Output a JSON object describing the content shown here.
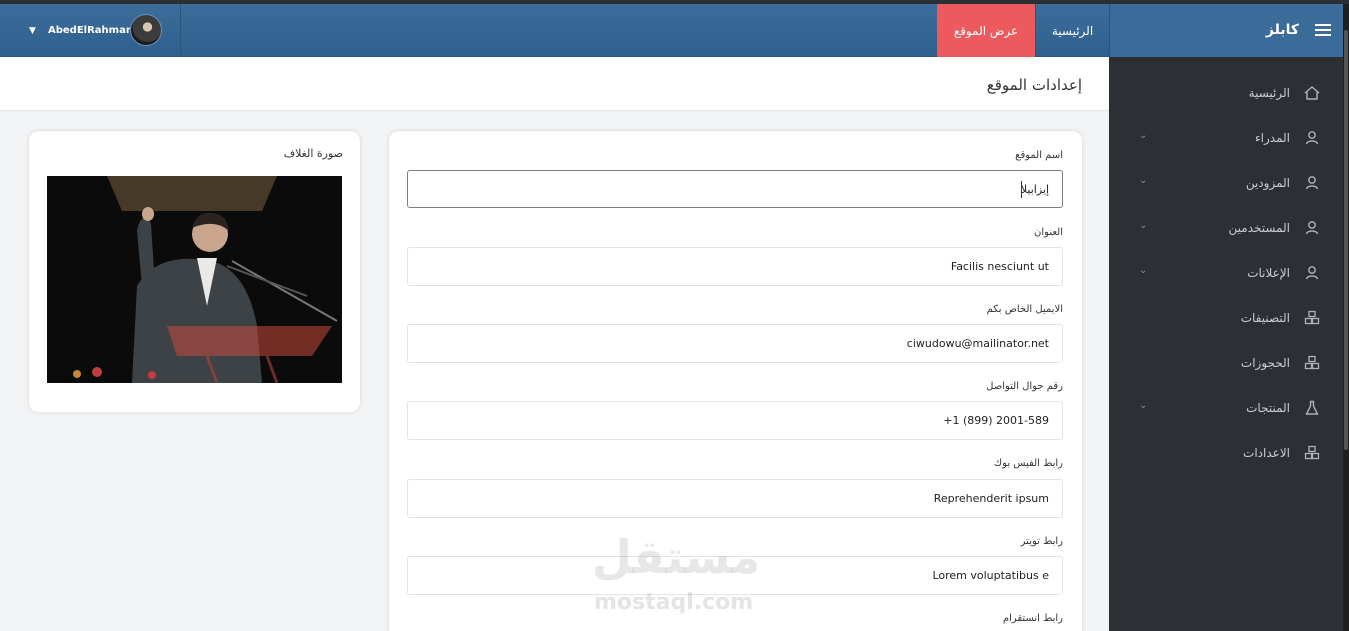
{
  "header": {
    "brand": "كابلز",
    "nav_home": "الرئيسية",
    "nav_view_site": "عرض الموقع",
    "user_name": "AbedElRahman"
  },
  "page": {
    "title": "إعدادات الموقع"
  },
  "sidebar": {
    "items": [
      {
        "label": "الرئيسية",
        "icon": "home-icon",
        "has_caret": false
      },
      {
        "label": "المدراء",
        "icon": "user-icon",
        "has_caret": true
      },
      {
        "label": "المزودين",
        "icon": "user-icon",
        "has_caret": true
      },
      {
        "label": "المستخدمين",
        "icon": "user-icon",
        "has_caret": true
      },
      {
        "label": "الإعلانات",
        "icon": "user-icon",
        "has_caret": true
      },
      {
        "label": "التصنيفات",
        "icon": "cubes-icon",
        "has_caret": false
      },
      {
        "label": "الحجوزات",
        "icon": "cubes-icon",
        "has_caret": false
      },
      {
        "label": "المنتجات",
        "icon": "flask-icon",
        "has_caret": true
      },
      {
        "label": "الاعدادات",
        "icon": "cubes-icon",
        "has_caret": false
      }
    ]
  },
  "form": {
    "site_name": {
      "label": "اسم الموقع",
      "value": "إيزابيلا"
    },
    "address": {
      "label": "العنوان",
      "value": "Facilis nesciunt ut"
    },
    "email": {
      "label": "الايميل الخاص بكم",
      "value": "ciwudowu@mailinator.net"
    },
    "phone": {
      "label": "رقم جوال التواصل",
      "value": "+1 (899) 2001-589"
    },
    "facebook": {
      "label": "رابط الفيس بوك",
      "value": "Reprehenderit ipsum"
    },
    "twitter": {
      "label": "رابط تويتر",
      "value": "Lorem voluptatibus e"
    },
    "instagram": {
      "label": "رابط انستقرام"
    }
  },
  "cover": {
    "title": "صورة الغلاف"
  },
  "watermark": {
    "arabic": "مستقل",
    "latin": "mostaql.com"
  },
  "colors": {
    "header": "#3a6b99",
    "view_site": "#ed5a5e",
    "sidebar": "#2c3034",
    "background": "#f2f3f5"
  }
}
